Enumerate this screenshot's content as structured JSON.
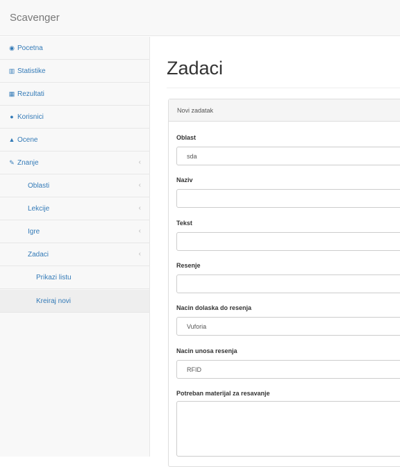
{
  "app": {
    "title": "Scavenger"
  },
  "sidebar": {
    "items": [
      {
        "label": "Pocetna",
        "icon": "dashboard-icon"
      },
      {
        "label": "Statistike",
        "icon": "bar-chart-icon"
      },
      {
        "label": "Rezultati",
        "icon": "table-icon"
      },
      {
        "label": "Korisnici",
        "icon": "users-icon"
      },
      {
        "label": "Ocene",
        "icon": "graduation-cap-icon"
      },
      {
        "label": "Znanje",
        "icon": "edit-icon"
      },
      {
        "label": "Oblasti"
      },
      {
        "label": "Lekcije"
      },
      {
        "label": "Igre"
      },
      {
        "label": "Zadaci"
      },
      {
        "label": "Prikazi listu"
      },
      {
        "label": "Kreiraj novi"
      }
    ],
    "chevron": "‹"
  },
  "main": {
    "title": "Zadaci",
    "panel_heading": "Novi zadatak",
    "fields": {
      "oblast": {
        "label": "Oblast",
        "value": "sda"
      },
      "naziv": {
        "label": "Naziv",
        "value": ""
      },
      "tekst": {
        "label": "Tekst",
        "value": ""
      },
      "resenje": {
        "label": "Resenje",
        "value": ""
      },
      "nacin_dolaska": {
        "label": "Nacin dolaska do resenja",
        "value": "Vuforia"
      },
      "nacin_unosa": {
        "label": "Nacin unosa resenja",
        "value": "RFID"
      },
      "materijal": {
        "label": "Potreban materijal za resavanje",
        "value": ""
      }
    }
  },
  "colors": {
    "link": "#337ab7",
    "sidebar_bg": "#f8f8f8",
    "active_bg": "#eeeeee"
  }
}
